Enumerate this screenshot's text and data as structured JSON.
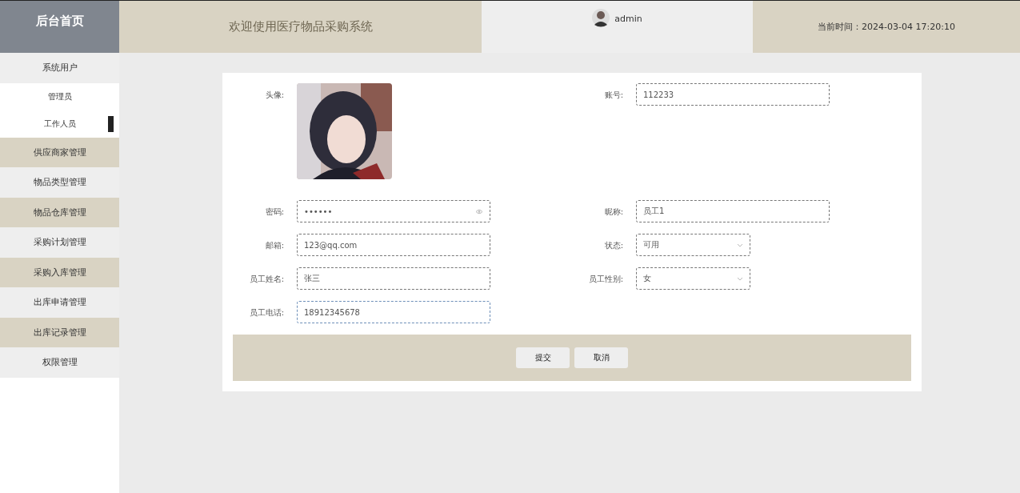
{
  "header": {
    "brand": "后台首页",
    "title": "欢迎使用医疗物品采购系统",
    "user": "admin",
    "time": "当前时间：2024-03-04 17:20:10"
  },
  "sidebar": {
    "items": [
      {
        "label": "系统用户",
        "kind": "group"
      },
      {
        "label": "管理员",
        "kind": "sub",
        "selected": false
      },
      {
        "label": "工作人员",
        "kind": "sub",
        "selected": true
      },
      {
        "label": "供应商家管理",
        "kind": "group"
      },
      {
        "label": "物品类型管理",
        "kind": "group"
      },
      {
        "label": "物品仓库管理",
        "kind": "group"
      },
      {
        "label": "采购计划管理",
        "kind": "group"
      },
      {
        "label": "采购入库管理",
        "kind": "group"
      },
      {
        "label": "出库申请管理",
        "kind": "group"
      },
      {
        "label": "出库记录管理",
        "kind": "group"
      },
      {
        "label": "权限管理",
        "kind": "group"
      }
    ]
  },
  "form": {
    "rows": [
      [
        {
          "label": "头像:"
        },
        {
          "label": "账号:",
          "kind": "text",
          "value": "112233"
        }
      ],
      [
        {
          "label": "密码:",
          "kind": "password",
          "value": "••••••"
        },
        {
          "label": "昵称:",
          "kind": "text",
          "value": "员工1"
        }
      ],
      [
        {
          "label": "邮箱:",
          "kind": "text",
          "value": "123@qq.com"
        },
        {
          "label": "状态:",
          "kind": "select",
          "value": "可用"
        }
      ],
      [
        {
          "label": "员工姓名:",
          "kind": "text",
          "value": "张三"
        },
        {
          "label": "员工性别:",
          "kind": "select",
          "value": "女"
        }
      ],
      [
        {
          "label": "员工电话:",
          "kind": "text",
          "value": "18912345678",
          "focused": true
        }
      ]
    ],
    "buttons": [
      "提交",
      "取消"
    ]
  }
}
